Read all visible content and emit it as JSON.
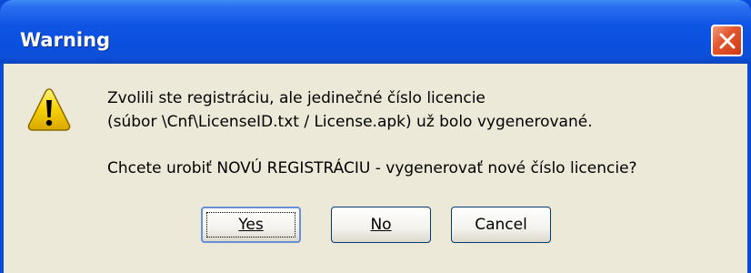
{
  "window": {
    "title": "Warning",
    "close_label": "Close"
  },
  "icon": {
    "name": "warning-icon",
    "color": "#f6d100"
  },
  "message": {
    "line1": "Zvolili ste registráciu, ale jedinečné číslo licencie",
    "line2": "(súbor \\Cnf\\LicenseID.txt / License.apk) už bolo vygenerované.",
    "line3": "Chcete urobiť NOVÚ REGISTRÁCIU - vygenerovať nové číslo licencie?"
  },
  "buttons": {
    "yes": "Yes",
    "no": "No",
    "cancel": "Cancel"
  },
  "colors": {
    "titlebar": "#0a4fde",
    "dialog_bg": "#ece9d8",
    "close_button": "#e4582f"
  }
}
